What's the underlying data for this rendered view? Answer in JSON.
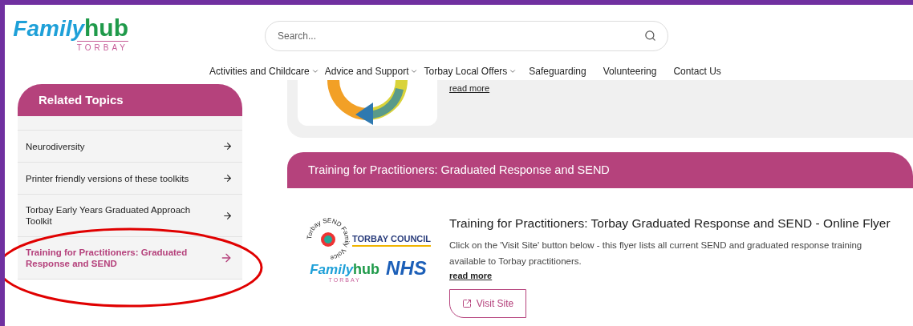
{
  "logo": {
    "word_1": "Family",
    "word_2": "hub",
    "place": "TORBAY"
  },
  "search": {
    "placeholder": "Search..."
  },
  "nav": [
    {
      "label": "Activities and Childcare",
      "dropdown": true
    },
    {
      "label": "Advice and Support",
      "dropdown": true
    },
    {
      "label": "Torbay Local Offers",
      "dropdown": true
    },
    {
      "label": "Safeguarding",
      "dropdown": false
    },
    {
      "label": "Volunteering",
      "dropdown": false
    },
    {
      "label": "Contact Us",
      "dropdown": false
    }
  ],
  "sidebar": {
    "title": "Related Topics",
    "items": [
      {
        "label": "Neurodiversity",
        "selected": false
      },
      {
        "label": "Printer friendly versions of these toolkits",
        "selected": false
      },
      {
        "label": "Torbay Early Years Graduated Approach Toolkit",
        "selected": false
      },
      {
        "label": "Training for Practitioners: Graduated Response and SEND",
        "selected": true
      }
    ]
  },
  "previous_card": {
    "link": "read more"
  },
  "section": {
    "title": "Training for Practitioners: Graduated Response and SEND",
    "card": {
      "logo": {
        "ring_text": "Torbay SEND Family Voice",
        "council": "TORBAY COUNCIL",
        "hub_1": "Family",
        "hub_2": "hub",
        "hub_place": "TORBAY",
        "nhs": "NHS"
      },
      "title": "Training for Practitioners: Torbay Graduated Response and SEND - Online Flyer",
      "description": "Click on the 'Visit Site' button below - this flyer lists all current SEND and graduated response training available to Torbay practitioners.",
      "link": "read more",
      "button": "Visit Site"
    }
  },
  "annotation": {
    "kind": "ellipse",
    "color": "#e00000"
  }
}
